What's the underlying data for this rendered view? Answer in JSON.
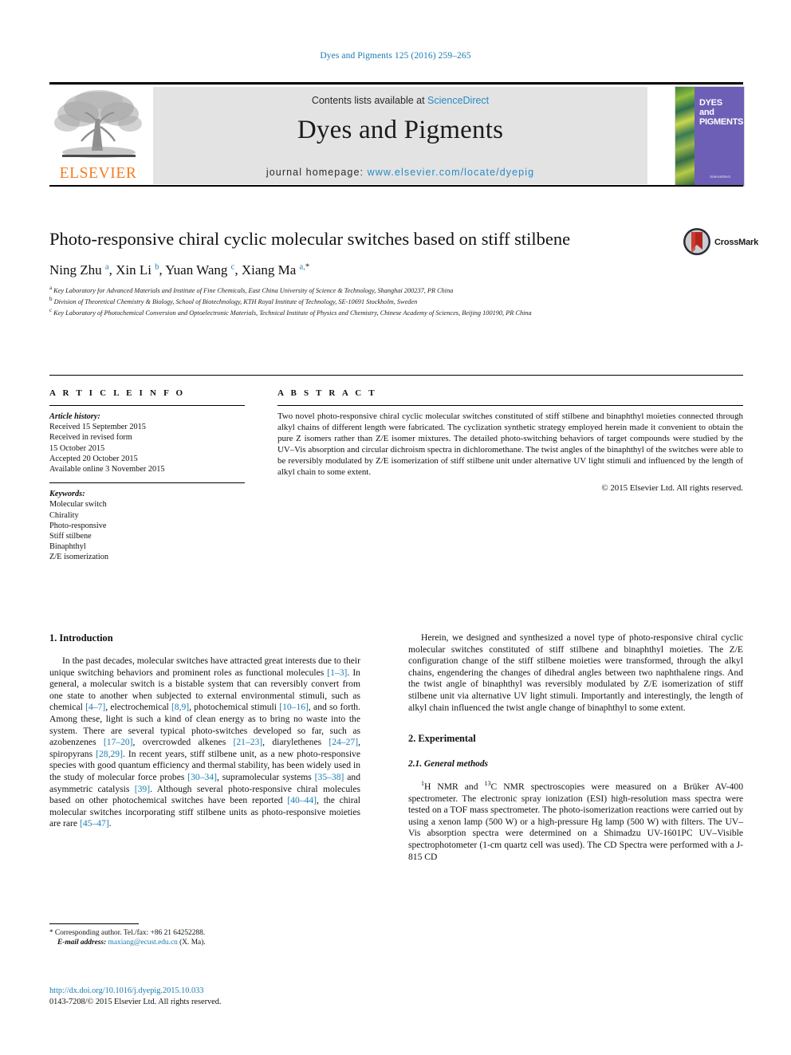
{
  "running_head": "Dyes and Pigments 125 (2016) 259–265",
  "masthead": {
    "contents_prefix": "Contents lists available at ",
    "sciencedirect": "ScienceDirect",
    "journal_name": "Dyes and Pigments",
    "homepage_prefix": "journal homepage: ",
    "homepage_url": "www.elsevier.com/locate/dyepig",
    "publisher": "ELSEVIER",
    "cover_title_line1": "DYES",
    "cover_title_line2": "and",
    "cover_title_line3": "PIGMENTS",
    "cover_footer": "ScienceDirect",
    "accent_blue": "#2a8ac4",
    "elsevier_orange": "#f57c20",
    "cover_purple": "#6d5fb5"
  },
  "article": {
    "title": "Photo-responsive chiral cyclic molecular switches based on stiff stilbene",
    "authors_html": "Ning Zhu <sup>a</sup>, Xin Li <sup>b</sup>, Yuan Wang <sup>c</sup>, Xiang Ma <sup>a,</sup><sup class=\"star\">*</sup>",
    "affiliations": [
      "a Key Laboratory for Advanced Materials and Institute of Fine Chemicals, East China University of Science & Technology, Shanghai 200237, PR China",
      "b Division of Theoretical Chemistry & Biology, School of Biotechnology, KTH Royal Institute of Technology, SE-10691 Stockholm, Sweden",
      "c Key Laboratory of Photochemical Conversion and Optoelectronic Materials, Technical Institute of Physics and Chemistry, Chinese Academy of Sciences, Beijing 100190, PR China"
    ],
    "crossmark_label": "CrossMark"
  },
  "info": {
    "heading": "A R T I C L E   I N F O",
    "history_label": "Article history:",
    "history": [
      "Received 15 September 2015",
      "Received in revised form",
      "15 October 2015",
      "Accepted 20 October 2015",
      "Available online 3 November 2015"
    ],
    "keywords_label": "Keywords:",
    "keywords": [
      "Molecular switch",
      "Chirality",
      "Photo-responsive",
      "Stiff stilbene",
      "Binaphthyl",
      "Z/E isomerization"
    ]
  },
  "abstract": {
    "heading": "A B S T R A C T",
    "text": "Two novel photo-responsive chiral cyclic molecular switches constituted of stiff stilbene and binaphthyl moieties connected through alkyl chains of different length were fabricated. The cyclization synthetic strategy employed herein made it convenient to obtain the pure Z isomers rather than Z/E isomer mixtures. The detailed photo-switching behaviors of target compounds were studied by the UV–Vis absorption and circular dichroism spectra in dichloromethane. The twist angles of the binaphthyl of the switches were able to be reversibly modulated by Z/E isomerization of stiff stilbene unit under alternative UV light stimuli and influenced by the length of alkyl chain to some extent.",
    "copyright": "© 2015 Elsevier Ltd. All rights reserved."
  },
  "body": {
    "intro_heading": "1. Introduction",
    "intro_p1_parts": [
      "In the past decades, molecular switches have attracted great interests due to their unique switching behaviors and prominent roles as functional molecules ",
      "[1–3]",
      ". In general, a molecular switch is a bistable system that can reversibly convert from one state to another when subjected to external environmental stimuli, such as chemical ",
      "[4–7]",
      ", electrochemical ",
      "[8,9]",
      ", photochemical stimuli ",
      "[10–16]",
      ", and so forth. Among these, light is such a kind of clean energy as to bring no waste into the system. There are several typical photo-switches developed so far, such as azobenzenes ",
      "[17–20]",
      ", overcrowded alkenes ",
      "[21–23]",
      ", diarylethenes ",
      "[24–27]",
      ", spiropyrans ",
      "[28,29]",
      ". In recent years, stiff stilbene unit, as a new photo-responsive species with good quantum efficiency and thermal stability, has been widely used in the study of molecular force probes ",
      "[30–34]",
      ", supramolecular systems ",
      "[35–38]",
      " and asymmetric catalysis ",
      "[39]",
      ". Although several photo-responsive chiral molecules based on other photochemical switches have been reported ",
      "[40–44]",
      ", the chiral molecular switches incorporating stiff stilbene units as photo-responsive moieties are rare ",
      "[45–47]",
      "."
    ],
    "right_p1": "Herein, we designed and synthesized a novel type of photo-responsive chiral cyclic molecular switches constituted of stiff stilbene and binaphthyl moieties. The Z/E configuration change of the stiff stilbene moieties were transformed, through the alkyl chains, engendering the changes of dihedral angles between two naphthalene rings. And the twist angle of binaphthyl was reversibly modulated by Z/E isomerization of stiff stilbene unit via alternative UV light stimuli. Importantly and interestingly, the length of alkyl chain influenced the twist angle change of binaphthyl to some extent.",
    "exp_heading": "2. Experimental",
    "exp_sub_heading": "2.1. General methods",
    "exp_p1_prefix": "H NMR and ",
    "exp_p1_sup1": "1",
    "exp_p1_sup2": "13",
    "exp_p1_rest": "C NMR spectroscopies were measured on a Brüker AV-400 spectrometer. The electronic spray ionization (ESI) high-resolution mass spectra were tested on a TOF mass spectrometer. The photo-isomerization reactions were carried out by using a xenon lamp (500 W) or a high-pressure Hg lamp (500 W) with filters. The UV–Vis absorption spectra were determined on a Shimadzu UV-1601PC UV–Visible spectrophotometer (1-cm quartz cell was used). The CD Spectra were performed with a J-815 CD"
  },
  "footnote": {
    "star": "*",
    "corresponding": " Corresponding author. Tel./fax: +86 21 64252288.",
    "email_label": "E-mail address:",
    "email": "maxiang@ecust.edu.cn",
    "email_suffix": " (X. Ma)."
  },
  "footer": {
    "doi": "http://dx.doi.org/10.1016/j.dyepig.2015.10.033",
    "issn_line": "0143-7208/© 2015 Elsevier Ltd. All rights reserved."
  }
}
